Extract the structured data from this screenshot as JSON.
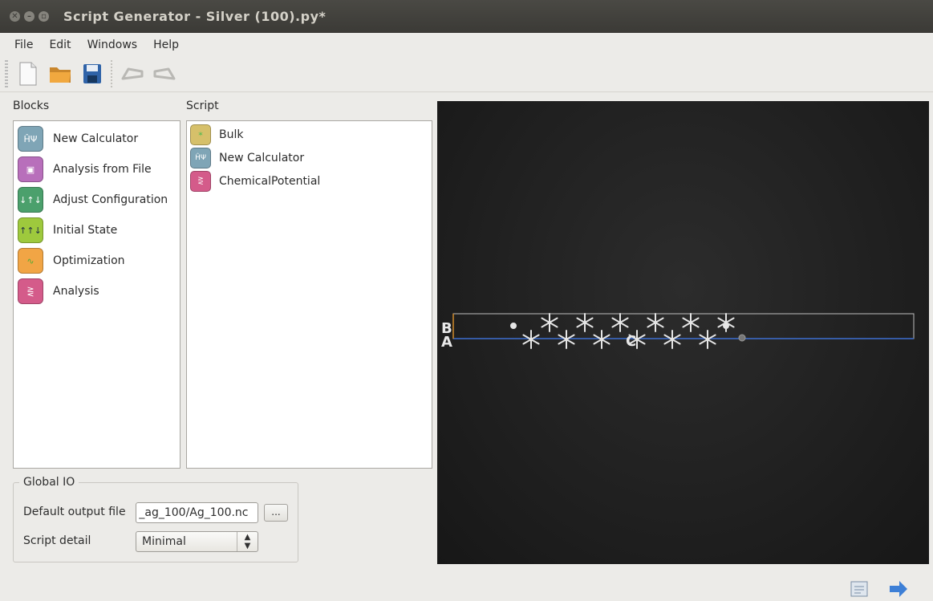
{
  "window": {
    "title": "Script Generator - Silver (100).py*"
  },
  "menu": [
    "File",
    "Edit",
    "Windows",
    "Help"
  ],
  "toolbar": {
    "icons": [
      "new-file-icon",
      "open-folder-icon",
      "save-icon",
      "undo-icon",
      "redo-icon"
    ]
  },
  "blocks": {
    "label": "Blocks",
    "items": [
      {
        "label": "New Calculator",
        "icon": "calculator-icon",
        "color": "#7fa5b6"
      },
      {
        "label": "Analysis from File",
        "icon": "disk-icon",
        "color": "#b86fbb"
      },
      {
        "label": "Adjust Configuration",
        "icon": "adjust-icon",
        "color": "#4ba06c"
      },
      {
        "label": "Initial State",
        "icon": "arrows-icon",
        "color": "#9ec93d"
      },
      {
        "label": "Optimization",
        "icon": "optimization-icon",
        "color": "#f1a545"
      },
      {
        "label": "Analysis",
        "icon": "analysis-icon",
        "color": "#d45b8a"
      }
    ]
  },
  "script": {
    "label": "Script",
    "items": [
      {
        "label": "Bulk",
        "icon": "bulk-icon",
        "color": "#d6c06a"
      },
      {
        "label": "New Calculator",
        "icon": "calculator-icon",
        "color": "#7fa5b6"
      },
      {
        "label": "ChemicalPotential",
        "icon": "analysis-icon",
        "color": "#d45b8a"
      }
    ]
  },
  "global_io": {
    "legend": "Global IO",
    "output_label": "Default output file",
    "output_value": " _ag_100/Ag_100.nc",
    "browse_label": "...",
    "detail_label": "Script detail",
    "detail_value": "Minimal"
  },
  "viewer": {
    "axis_labels": [
      "B",
      "A",
      "C"
    ]
  },
  "colors": {
    "titlebar": "#3e3d39",
    "viewer_bg": "#1e1e1e",
    "cell_line": "#3d6fd1"
  }
}
